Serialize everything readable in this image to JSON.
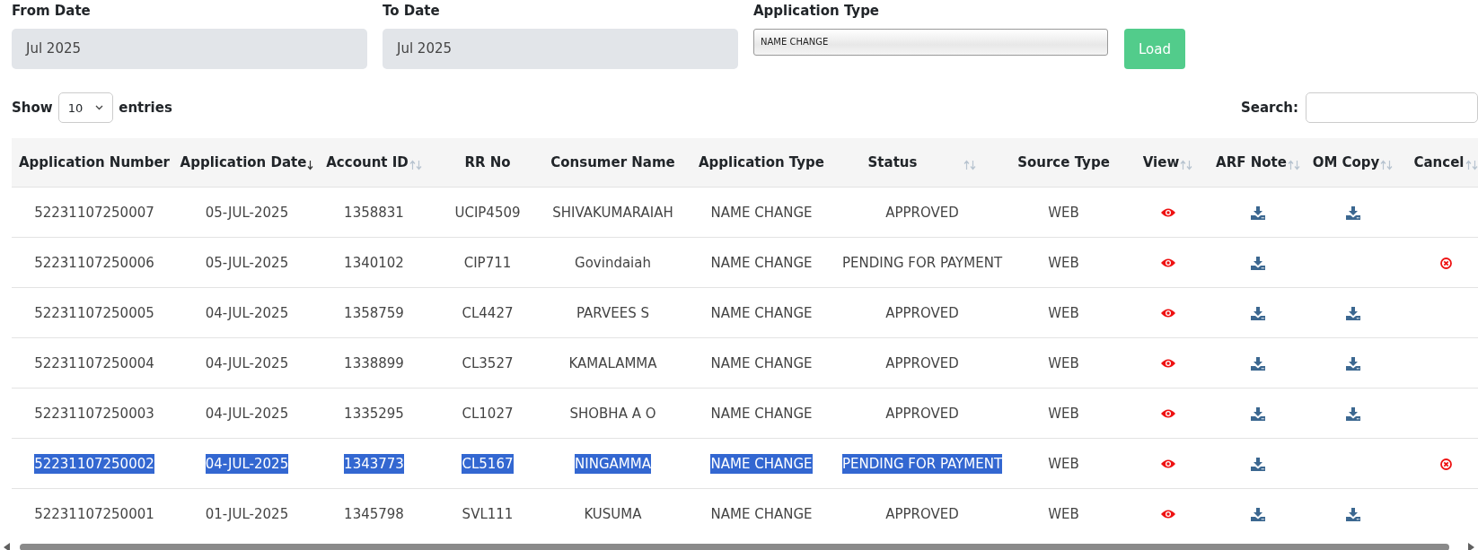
{
  "filters": {
    "from_date": {
      "label": "From Date",
      "value": "Jul 2025"
    },
    "to_date": {
      "label": "To Date",
      "value": "Jul 2025"
    },
    "application_type": {
      "label": "Application Type",
      "value": "NAME CHANGE"
    },
    "load_button": "Load"
  },
  "length": {
    "show": "Show",
    "value": "10",
    "entries": "entries"
  },
  "search": {
    "label": "Search:"
  },
  "table": {
    "columns": [
      {
        "label": "Application Number",
        "sortable": false
      },
      {
        "label": "Application Date",
        "sortable": true,
        "sorted_descending": true
      },
      {
        "label": "Account ID",
        "sortable": true,
        "sorted_descending": false
      },
      {
        "label": "RR No",
        "sortable": false
      },
      {
        "label": "Consumer Name",
        "sortable": false
      },
      {
        "label": "Application Type",
        "sortable": false
      },
      {
        "label": "Status",
        "sortable": true,
        "sorted_descending": false
      },
      {
        "label": "Source Type",
        "sortable": false
      },
      {
        "label": "View",
        "sortable": true,
        "sorted_descending": false
      },
      {
        "label": "ARF Note",
        "sortable": true,
        "sorted_descending": false
      },
      {
        "label": "OM Copy",
        "sortable": true,
        "sorted_descending": false
      },
      {
        "label": "Cancel",
        "sortable": true,
        "sorted_descending": false
      }
    ],
    "rows": [
      {
        "cells": [
          "52231107250007",
          "05-JUL-2025",
          "1358831",
          "UCIP4509",
          "SHIVAKUMARAIAH",
          "NAME CHANGE",
          "APPROVED",
          "WEB"
        ],
        "view": true,
        "arf_note": true,
        "om_copy": true,
        "cancel": false,
        "text_selected": false
      },
      {
        "cells": [
          "52231107250006",
          "05-JUL-2025",
          "1340102",
          "CIP711",
          "Govindaiah",
          "NAME CHANGE",
          "PENDING FOR PAYMENT",
          "WEB"
        ],
        "view": true,
        "arf_note": true,
        "om_copy": false,
        "cancel": true,
        "text_selected": false
      },
      {
        "cells": [
          "52231107250005",
          "04-JUL-2025",
          "1358759",
          "CL4427",
          "PARVEES S",
          "NAME CHANGE",
          "APPROVED",
          "WEB"
        ],
        "view": true,
        "arf_note": true,
        "om_copy": true,
        "cancel": false,
        "text_selected": false
      },
      {
        "cells": [
          "52231107250004",
          "04-JUL-2025",
          "1338899",
          "CL3527",
          "KAMALAMMA",
          "NAME CHANGE",
          "APPROVED",
          "WEB"
        ],
        "view": true,
        "arf_note": true,
        "om_copy": true,
        "cancel": false,
        "text_selected": false
      },
      {
        "cells": [
          "52231107250003",
          "04-JUL-2025",
          "1335295",
          "CL1027",
          "SHOBHA A O",
          "NAME CHANGE",
          "APPROVED",
          "WEB"
        ],
        "view": true,
        "arf_note": true,
        "om_copy": true,
        "cancel": false,
        "text_selected": false
      },
      {
        "cells": [
          "52231107250002",
          "04-JUL-2025",
          "1343773",
          "CL5167",
          "NINGAMMA",
          "NAME CHANGE",
          "PENDING FOR PAYMENT",
          "WEB"
        ],
        "view": true,
        "arf_note": true,
        "om_copy": false,
        "cancel": true,
        "text_selected": true
      },
      {
        "cells": [
          "52231107250001",
          "01-JUL-2025",
          "1345798",
          "SVL111",
          "KUSUMA",
          "NAME CHANGE",
          "APPROVED",
          "WEB"
        ],
        "view": true,
        "arf_note": true,
        "om_copy": true,
        "cancel": false,
        "text_selected": false
      }
    ]
  }
}
